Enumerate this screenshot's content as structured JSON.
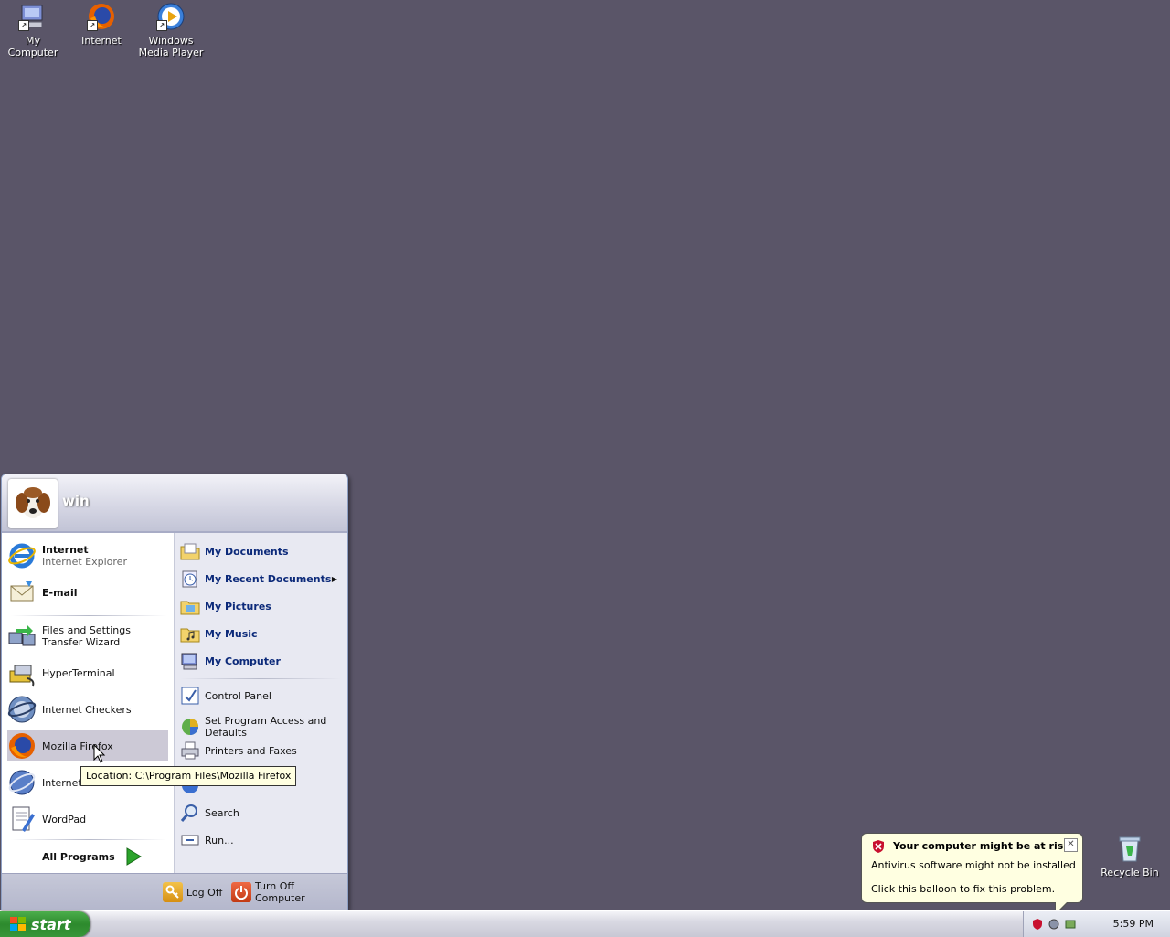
{
  "desktop": {
    "icons": [
      {
        "label": "My Computer"
      },
      {
        "label": "Internet"
      },
      {
        "label": "Windows Media Player"
      },
      {
        "label": "Recycle Bin"
      }
    ]
  },
  "start_menu": {
    "username": "win",
    "left_items": [
      {
        "title": "Internet",
        "subtitle": "Internet Explorer"
      },
      {
        "title": "E-mail"
      },
      {
        "label": "Files and Settings Transfer Wizard"
      },
      {
        "label": "HyperTerminal"
      },
      {
        "label": "Internet Checkers"
      },
      {
        "label": "Mozilla Firefox"
      },
      {
        "label": "Internet"
      },
      {
        "label": "WordPad"
      }
    ],
    "all_programs": "All Programs",
    "right_items": [
      {
        "label": "My Documents"
      },
      {
        "label": "My Recent Documents"
      },
      {
        "label": "My Pictures"
      },
      {
        "label": "My Music"
      },
      {
        "label": "My Computer"
      },
      {
        "label": "Control Panel"
      },
      {
        "label": "Set Program Access and Defaults"
      },
      {
        "label": "Printers and Faxes"
      },
      {
        "label": "Search"
      },
      {
        "label": "Run..."
      }
    ],
    "log_off": "Log Off",
    "turn_off": "Turn Off Computer"
  },
  "tooltip": "Location: C:\\Program Files\\Mozilla Firefox",
  "balloon": {
    "title": "Your computer might be at risk",
    "line1": "Antivirus software might not be installed",
    "line2": "Click this balloon to fix this problem."
  },
  "taskbar": {
    "start_label": "start",
    "clock": "5:59 PM"
  },
  "colors": {
    "desktop": "#5a5568",
    "start_green": "#2d8a2d",
    "balloon_bg": "#ffffe1"
  }
}
